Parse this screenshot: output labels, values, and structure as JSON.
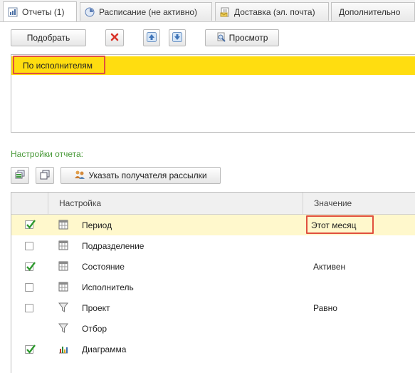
{
  "tabs": [
    {
      "label": "Отчеты (1)",
      "icon": "report-icon",
      "active": true
    },
    {
      "label": "Расписание (не активно)",
      "icon": "clock-icon",
      "active": false
    },
    {
      "label": "Доставка (эл. почта)",
      "icon": "mail-doc-icon",
      "active": false
    },
    {
      "label": "Дополнительно",
      "icon": "",
      "active": false
    }
  ],
  "toolbar": {
    "pick_label": "Подобрать",
    "preview_label": "Просмотр"
  },
  "reports_list": {
    "items": [
      "По исполнителям"
    ]
  },
  "settings": {
    "title": "Настройки отчета:",
    "recipient_label": "Указать получателя рассылки"
  },
  "table": {
    "col_setting": "Настройка",
    "col_value": "Значение",
    "rows": [
      {
        "checked": true,
        "icon": "calendar-table-icon",
        "name": "Период",
        "value": "Этот месяц",
        "current": true
      },
      {
        "checked": false,
        "icon": "calendar-table-icon",
        "name": "Подразделение",
        "value": ""
      },
      {
        "checked": true,
        "icon": "calendar-table-icon",
        "name": "Состояние",
        "value": "Активен"
      },
      {
        "checked": false,
        "icon": "calendar-table-icon",
        "name": "Исполнитель",
        "value": ""
      },
      {
        "checked": false,
        "icon": "filter-icon",
        "name": "Проект",
        "value": "Равно"
      },
      {
        "checked": null,
        "icon": "filter-icon",
        "name": "Отбор",
        "value": ""
      },
      {
        "checked": true,
        "icon": "bar-chart-icon",
        "name": "Диаграмма",
        "value": ""
      }
    ]
  },
  "colors": {
    "selection": "#ffdd10",
    "current_row": "#fff8cc",
    "highlight_border": "#e0503e",
    "section_label": "#4a9a3a",
    "check": "#2f9a2f"
  }
}
